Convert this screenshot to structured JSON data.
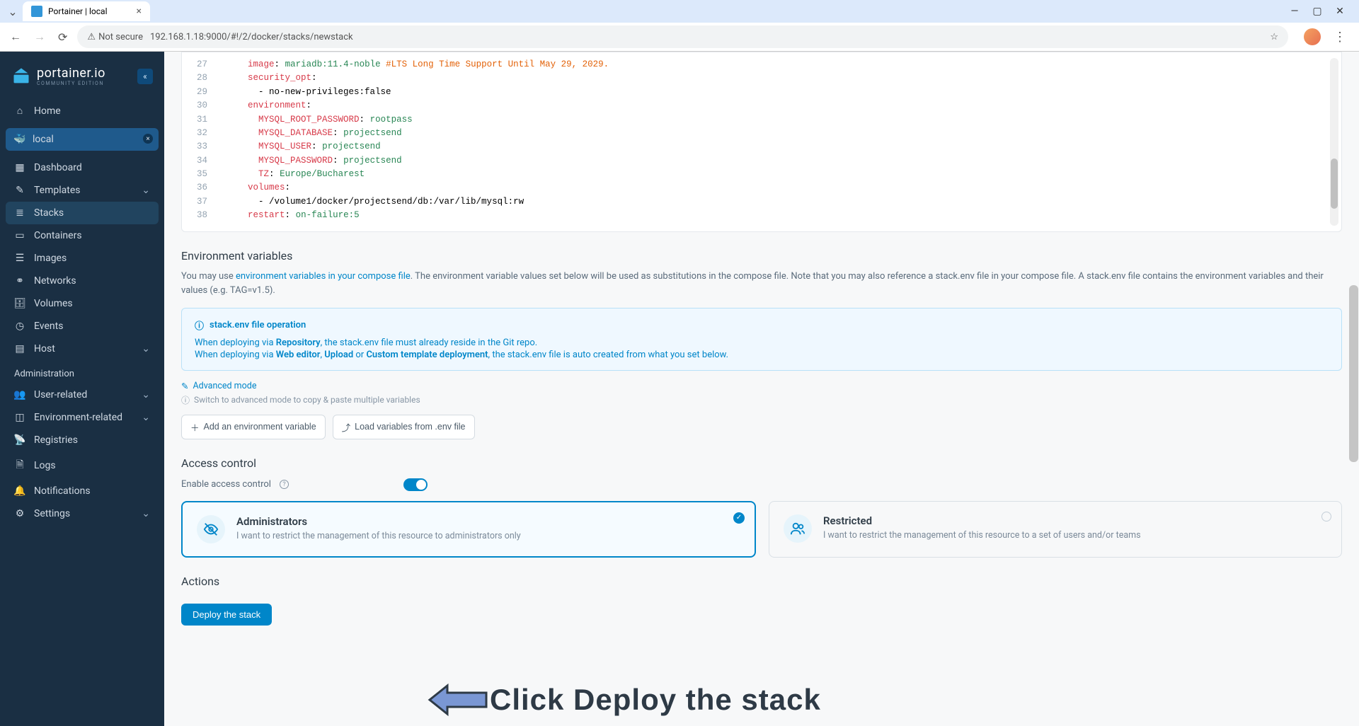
{
  "browser": {
    "tab_title": "Portainer | local",
    "url": "192.168.1.18:9000/#!/2/docker/stacks/newstack",
    "not_secure": "Not secure"
  },
  "sidebar": {
    "brand": "portainer.io",
    "brand_sub": "COMMUNITY EDITION",
    "home": "Home",
    "env_name": "local",
    "items": [
      {
        "label": "Dashboard",
        "icon": "grid"
      },
      {
        "label": "Templates",
        "icon": "edit",
        "expandable": true
      },
      {
        "label": "Stacks",
        "icon": "layers",
        "active": true
      },
      {
        "label": "Containers",
        "icon": "box"
      },
      {
        "label": "Images",
        "icon": "list"
      },
      {
        "label": "Networks",
        "icon": "share"
      },
      {
        "label": "Volumes",
        "icon": "database"
      },
      {
        "label": "Events",
        "icon": "clock"
      },
      {
        "label": "Host",
        "icon": "server",
        "expandable": true
      }
    ],
    "admin_header": "Administration",
    "admin_items": [
      {
        "label": "User-related",
        "icon": "users",
        "expandable": true
      },
      {
        "label": "Environment-related",
        "icon": "hdd",
        "expandable": true
      },
      {
        "label": "Registries",
        "icon": "signal"
      },
      {
        "label": "Logs",
        "icon": "file"
      },
      {
        "label": "Notifications",
        "icon": "bell"
      },
      {
        "label": "Settings",
        "icon": "gear",
        "expandable": true
      }
    ]
  },
  "code": {
    "lines": [
      {
        "n": 27,
        "indent": 3,
        "key": "image",
        "val": "mariadb:11.4-noble",
        "comment": "#LTS Long Time Support Until May 29, 2029."
      },
      {
        "n": 28,
        "indent": 3,
        "key": "security_opt",
        "val": ""
      },
      {
        "n": 29,
        "indent": 4,
        "plain": "- no-new-privileges:false"
      },
      {
        "n": 30,
        "indent": 3,
        "key": "environment",
        "val": ""
      },
      {
        "n": 31,
        "indent": 4,
        "key": "MYSQL_ROOT_PASSWORD",
        "val": "rootpass"
      },
      {
        "n": 32,
        "indent": 4,
        "key": "MYSQL_DATABASE",
        "val": "projectsend"
      },
      {
        "n": 33,
        "indent": 4,
        "key": "MYSQL_USER",
        "val": "projectsend"
      },
      {
        "n": 34,
        "indent": 4,
        "key": "MYSQL_PASSWORD",
        "val": "projectsend"
      },
      {
        "n": 35,
        "indent": 4,
        "key": "TZ",
        "val": "Europe/Bucharest"
      },
      {
        "n": 36,
        "indent": 3,
        "key": "volumes",
        "val": ""
      },
      {
        "n": 37,
        "indent": 4,
        "plain": "- /volume1/docker/projectsend/db:/var/lib/mysql:rw"
      },
      {
        "n": 38,
        "indent": 3,
        "key": "restart",
        "val": "on-failure:5"
      }
    ]
  },
  "env": {
    "title": "Environment variables",
    "desc_pre": "You may use ",
    "desc_link": "environment variables in your compose file",
    "desc_post": ". The environment variable values set below will be used as substitutions in the compose file. Note that you may also reference a stack.env file in your compose file. A stack.env file contains the environment variables and their values (e.g. TAG=v1.5).",
    "info_title": "stack.env file operation",
    "info_line1_pre": "When deploying via ",
    "info_line1_bold": "Repository",
    "info_line1_post": ", the stack.env file must already reside in the Git repo.",
    "info_line2_pre": "When deploying via ",
    "info_line2_b1": "Web editor",
    "info_line2_m1": ", ",
    "info_line2_b2": "Upload",
    "info_line2_m2": " or ",
    "info_line2_b3": "Custom template deployment",
    "info_line2_post": ", the stack.env file is auto created from what you set below.",
    "advanced": "Advanced mode",
    "hint": "Switch to advanced mode to copy & paste multiple variables",
    "btn_add": "Add an environment variable",
    "btn_load": "Load variables from .env file"
  },
  "access": {
    "title": "Access control",
    "enable_label": "Enable access control",
    "cards": {
      "admin": {
        "title": "Administrators",
        "desc": "I want to restrict the management of this resource to administrators only"
      },
      "restricted": {
        "title": "Restricted",
        "desc": "I want to restrict the management of this resource to a set of users and/or teams"
      }
    }
  },
  "actions": {
    "title": "Actions",
    "deploy": "Deploy the stack"
  },
  "annotation": "Click Deploy the stack"
}
